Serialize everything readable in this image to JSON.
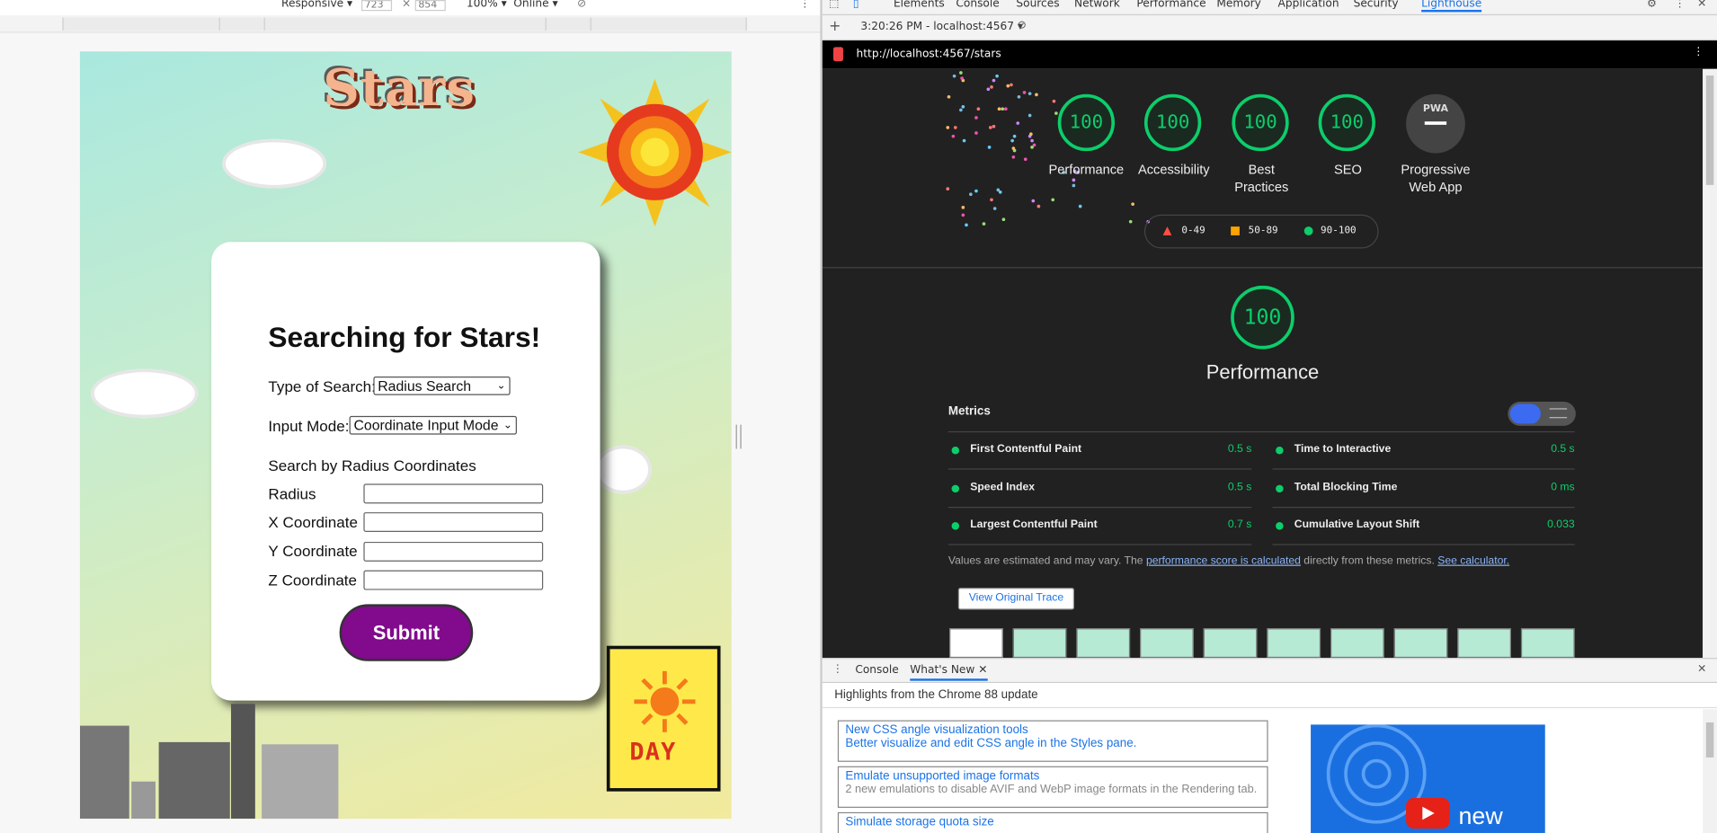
{
  "device_toolbar": {
    "mode": "Responsive",
    "width": "723",
    "height": "854",
    "zoom": "100%",
    "network": "Online"
  },
  "app": {
    "logo": "Stars",
    "title": "Searching for Stars!",
    "search_type_label": "Type of Search:",
    "search_type_value": "Radius Search",
    "input_mode_label": "Input Mode:",
    "input_mode_value": "Coordinate Input Mode",
    "section_label": "Search by Radius Coordinates",
    "fields": {
      "radius": "Radius",
      "x": "X Coordinate",
      "y": "Y Coordinate",
      "z": "Z Coordinate"
    },
    "submit_label": "Submit",
    "day_label": "DAY"
  },
  "devtools": {
    "tabs": [
      "Elements",
      "Console",
      "Sources",
      "Network",
      "Performance",
      "Memory",
      "Application",
      "Security",
      "Lighthouse"
    ],
    "active_tab": "Lighthouse",
    "report_selector": "3:20:26 PM - localhost:4567",
    "url": "http://localhost:4567/stars",
    "scores": [
      {
        "label": "Performance",
        "value": "100"
      },
      {
        "label": "Accessibility",
        "value": "100"
      },
      {
        "label": "Best Practices",
        "value": "100"
      },
      {
        "label": "SEO",
        "value": "100"
      }
    ],
    "pwa_label": "Progressive Web App",
    "pwa_badge": "PWA",
    "legend": {
      "low": "0-49",
      "mid": "50-89",
      "high": "90-100"
    },
    "perf_score": "100",
    "perf_title": "Performance",
    "metrics_title": "Metrics",
    "metrics": [
      {
        "name": "First Contentful Paint",
        "value": "0.5 s"
      },
      {
        "name": "Time to Interactive",
        "value": "0.5 s"
      },
      {
        "name": "Speed Index",
        "value": "0.5 s"
      },
      {
        "name": "Total Blocking Time",
        "value": "0 ms"
      },
      {
        "name": "Largest Contentful Paint",
        "value": "0.7 s"
      },
      {
        "name": "Cumulative Layout Shift",
        "value": "0.033"
      }
    ],
    "note_prefix": "Values are estimated and may vary. The ",
    "note_link": "performance score is calculated",
    "note_middle": " directly from these metrics. ",
    "note_link2": "See calculator.",
    "trace_button": "View Original Trace",
    "colors": {
      "pass": "#0cce6b",
      "average": "#ffa400",
      "fail": "#ff4e42",
      "bg": "#212121"
    }
  },
  "drawer": {
    "tabs": [
      "Console",
      "What's New"
    ],
    "active_tab": "What's New",
    "heading": "Highlights from the Chrome 88 update",
    "items": [
      {
        "title": "New CSS angle visualization tools",
        "desc": "Better visualize and edit CSS angle in the Styles pane."
      },
      {
        "title": "Emulate unsupported image formats",
        "desc": "2 new emulations to disable AVIF and WebP image formats in the Rendering tab."
      },
      {
        "title": "Simulate storage quota size",
        "desc": ""
      }
    ],
    "video_caption": "new"
  }
}
